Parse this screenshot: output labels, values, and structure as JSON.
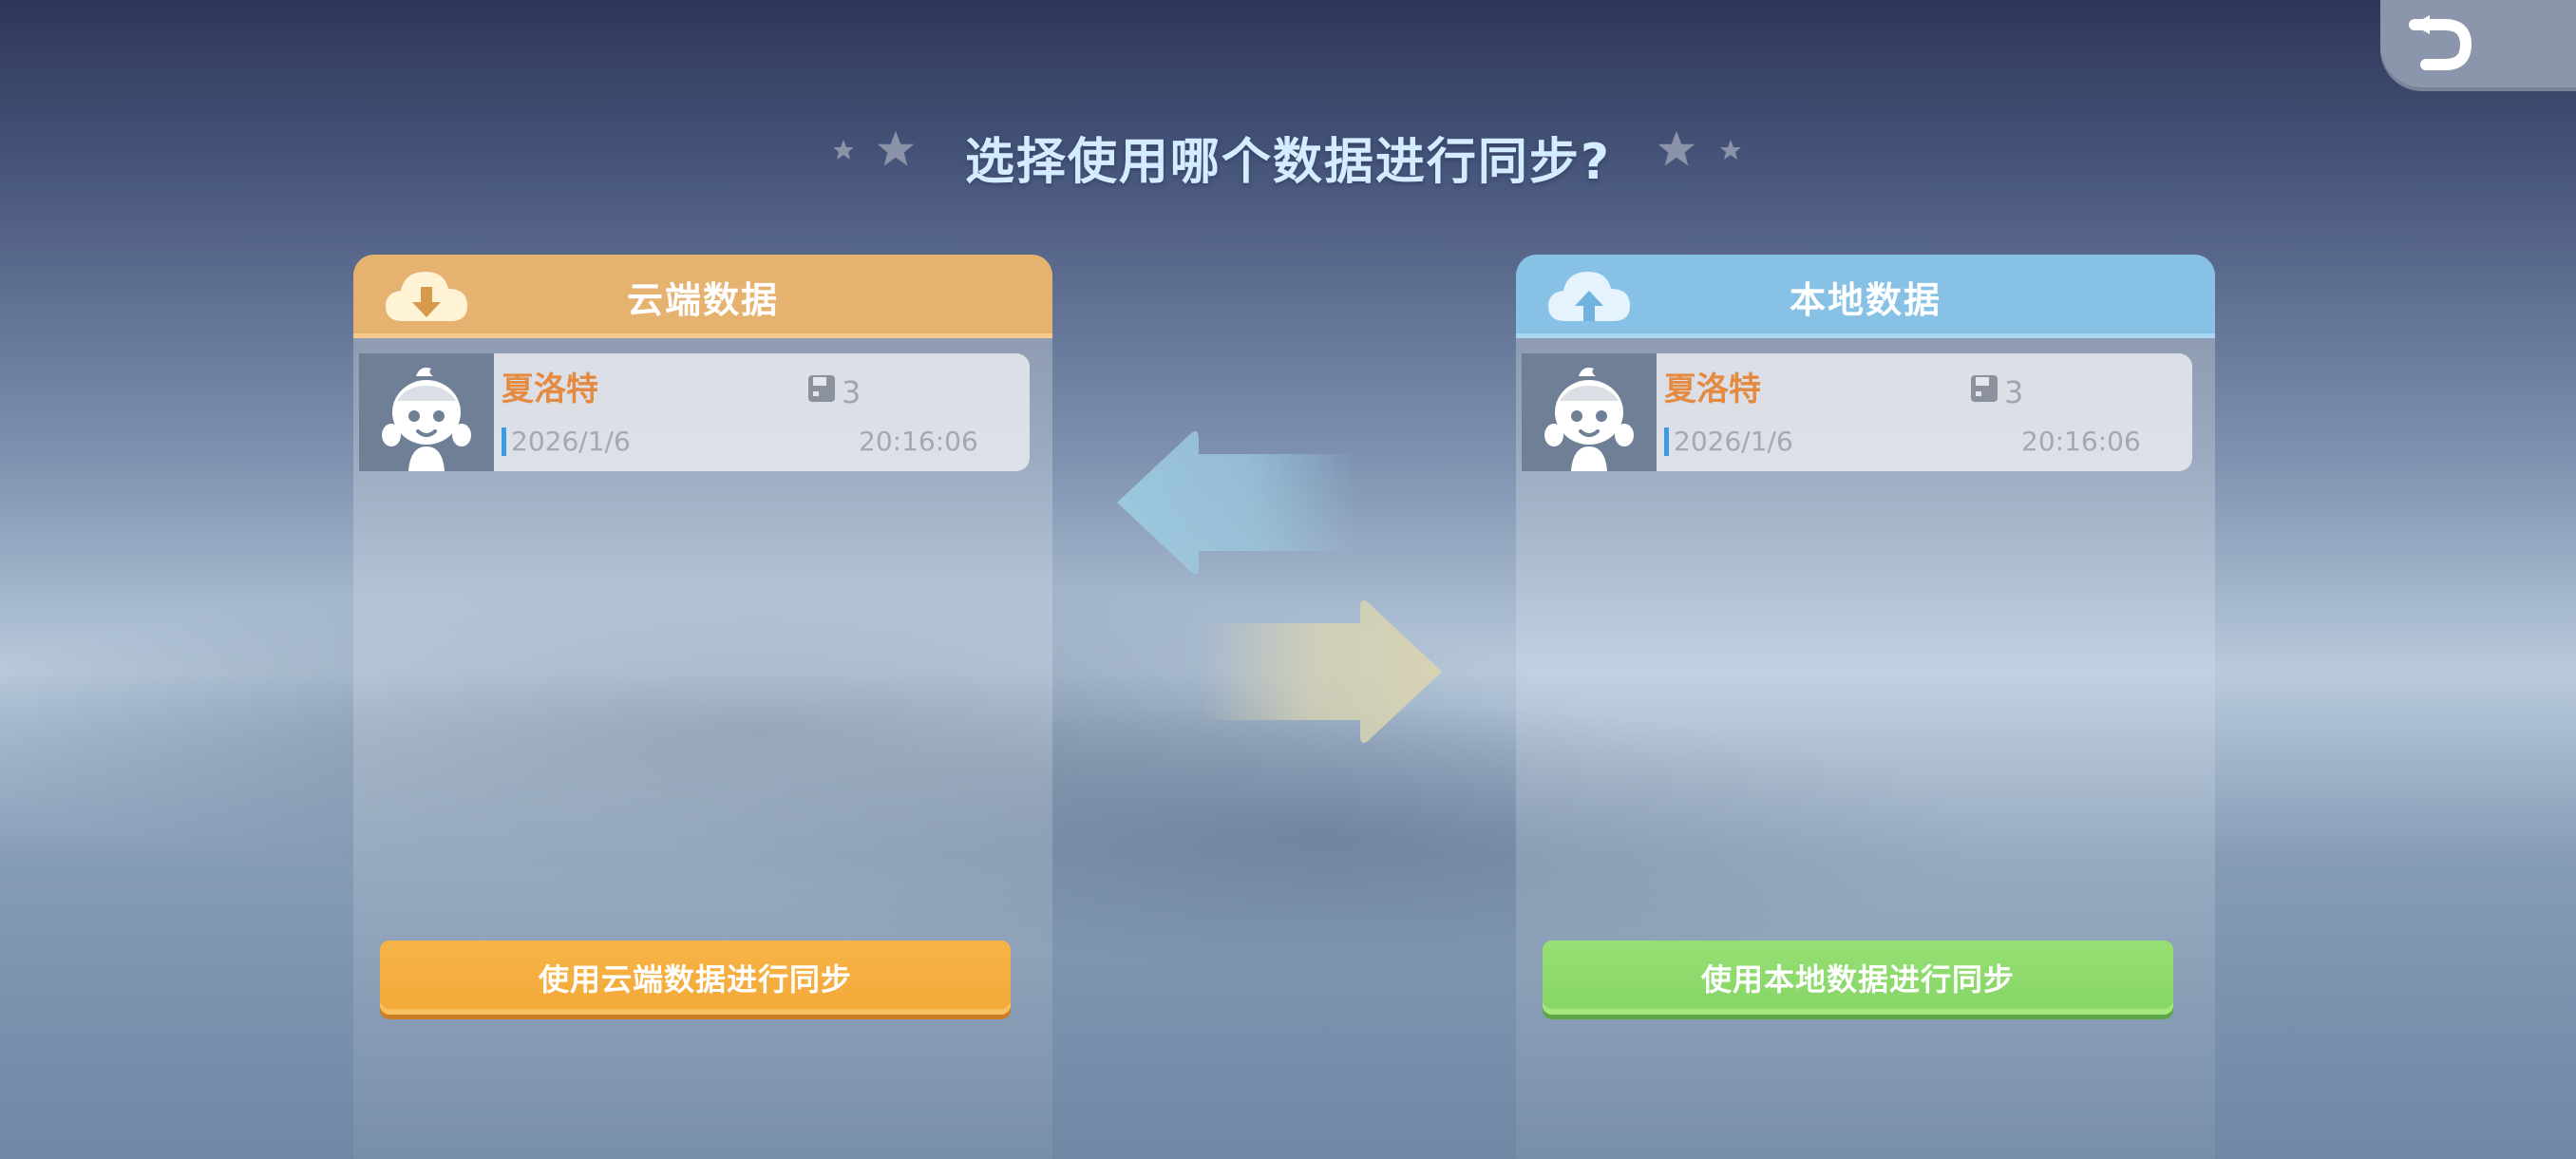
{
  "header": {
    "title": "选择使用哪个数据进行同步?",
    "back_icon": "back-arrow-icon"
  },
  "cloud": {
    "header_label": "云端数据",
    "header_icon": "cloud-download-icon",
    "save": {
      "name": "夏洛特",
      "count": "3",
      "date": "2026/1/6",
      "time": "20:16:06"
    },
    "button_label": "使用云端数据进行同步"
  },
  "local": {
    "header_label": "本地数据",
    "header_icon": "cloud-upload-icon",
    "save": {
      "name": "夏洛特",
      "count": "3",
      "date": "2026/1/6",
      "time": "20:16:06"
    },
    "button_label": "使用本地数据进行同步"
  },
  "colors": {
    "cloud_accent": "#e6b270",
    "local_accent": "#87c2e6",
    "cloud_button": "#f2a838",
    "local_button": "#86d565",
    "name_color": "#e58b41"
  }
}
